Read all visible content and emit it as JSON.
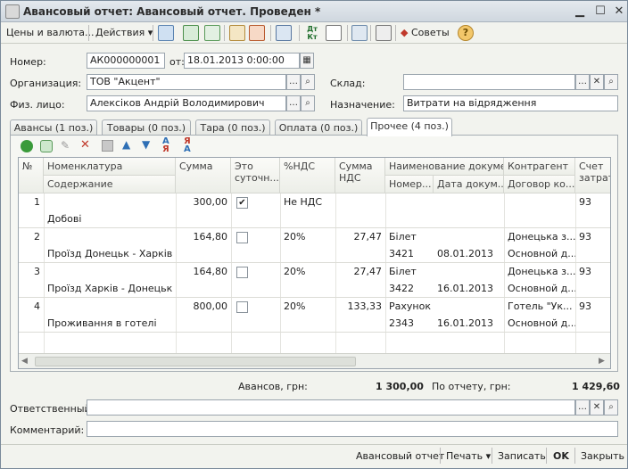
{
  "window": {
    "title": "Авансовый отчет: Авансовый отчет. Проведен *"
  },
  "toolbar": {
    "prices_label": "Цены и валюта...",
    "actions_label": "Действия",
    "advice_label": "Советы"
  },
  "header": {
    "number_label": "Номер:",
    "number_value": "АК000000001",
    "date_label": "от:",
    "date_value": "18.01.2013  0:00:00",
    "org_label": "Организация:",
    "org_value": "ТОВ \"Акцент\"",
    "warehouse_label": "Склад:",
    "warehouse_value": "",
    "person_label": "Физ. лицо:",
    "person_value": "Алексіков Андрій Володимирович",
    "purpose_label": "Назначение:",
    "purpose_value": "Витрати на відрядження"
  },
  "tabs": [
    {
      "label": "Авансы (1 поз.)"
    },
    {
      "label": "Товары (0 поз.)"
    },
    {
      "label": "Тара (0 поз.)"
    },
    {
      "label": "Оплата (0 поз.)"
    },
    {
      "label": "Прочее (4 поз.)"
    }
  ],
  "grid": {
    "headers": {
      "num": "№",
      "nomen": "Номенклатура",
      "content": "Содержание",
      "sum": "Сумма",
      "daily": "Это суточн...",
      "vat_rate": "%НДС",
      "vat_sum": "Сумма НДС",
      "doc_name": "Наименование докуме...",
      "doc_num": "Номер...",
      "doc_date": "Дата докум...",
      "contractor": "Контрагент",
      "contract": "Договор ко...",
      "account": "Счет затрат"
    },
    "rows": [
      {
        "n": "1",
        "nomen": "",
        "content": "Добові",
        "sum": "300,00",
        "daily": true,
        "vat_rate": "Не НДС",
        "vat_sum": "",
        "doc_name": "",
        "doc_num": "",
        "doc_date": "",
        "contractor": "",
        "contract": "",
        "account": "93"
      },
      {
        "n": "2",
        "nomen": "",
        "content": "Проїзд Донецьк - Харків",
        "sum": "164,80",
        "daily": false,
        "vat_rate": "20%",
        "vat_sum": "27,47",
        "doc_name": "Білет",
        "doc_num": "3421",
        "doc_date": "08.01.2013",
        "contractor": "Донецька з...",
        "contract": "Основной д...",
        "account": "93"
      },
      {
        "n": "3",
        "nomen": "",
        "content": "Проїзд Харків - Донецьк",
        "sum": "164,80",
        "daily": false,
        "vat_rate": "20%",
        "vat_sum": "27,47",
        "doc_name": "Білет",
        "doc_num": "3422",
        "doc_date": "16.01.2013",
        "contractor": "Донецька з...",
        "contract": "Основной д...",
        "account": "93"
      },
      {
        "n": "4",
        "nomen": "",
        "content": "Проживання в готелі",
        "sum": "800,00",
        "daily": false,
        "vat_rate": "20%",
        "vat_sum": "133,33",
        "doc_name": "Рахунок",
        "doc_num": "2343",
        "doc_date": "16.01.2013",
        "contractor": "Готель \"Ук...",
        "contract": "Основной д...",
        "account": "93"
      }
    ]
  },
  "totals": {
    "advances_label": "Авансов, грн:",
    "advances_value": "1 300,00",
    "report_label": "По отчету, грн:",
    "report_value": "1 429,60"
  },
  "footer": {
    "responsible_label": "Ответственный:",
    "responsible_value": "",
    "comment_label": "Комментарий:",
    "comment_value": ""
  },
  "bottom": {
    "print_form": "Авансовый отчет",
    "print": "Печать",
    "save": "Записать",
    "ok": "OK",
    "close": "Закрыть"
  },
  "colors": {
    "accent": "#1f6e2c",
    "titlebar": "#cfd7df"
  }
}
